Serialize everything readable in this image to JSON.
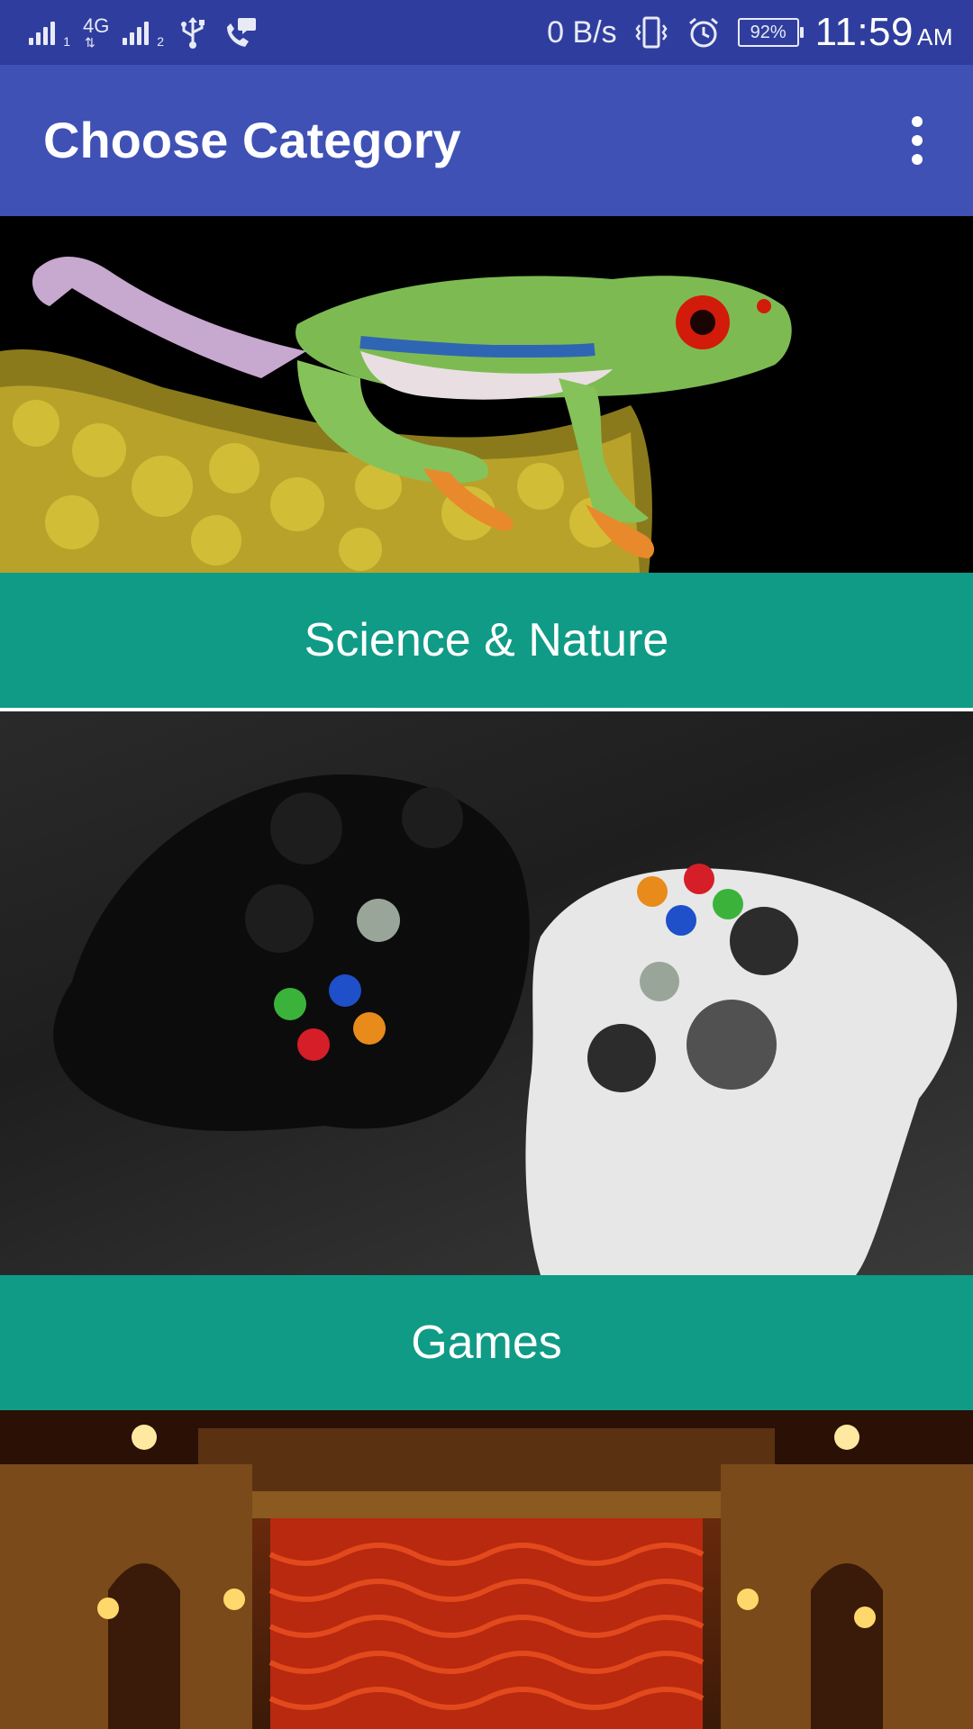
{
  "status_bar": {
    "sim1_index": "1",
    "sim2_index": "2",
    "network_type": "4G",
    "net_speed": "0 B/s",
    "battery": "92%",
    "time": "11:59",
    "ampm": "AM"
  },
  "app_bar": {
    "title": "Choose Category"
  },
  "categories": [
    {
      "label": "Science & Nature"
    },
    {
      "label": "Games"
    }
  ],
  "colors": {
    "status_bar": "#2f3e9e",
    "app_bar": "#3f51b5",
    "category_label_bg": "#109b86"
  }
}
